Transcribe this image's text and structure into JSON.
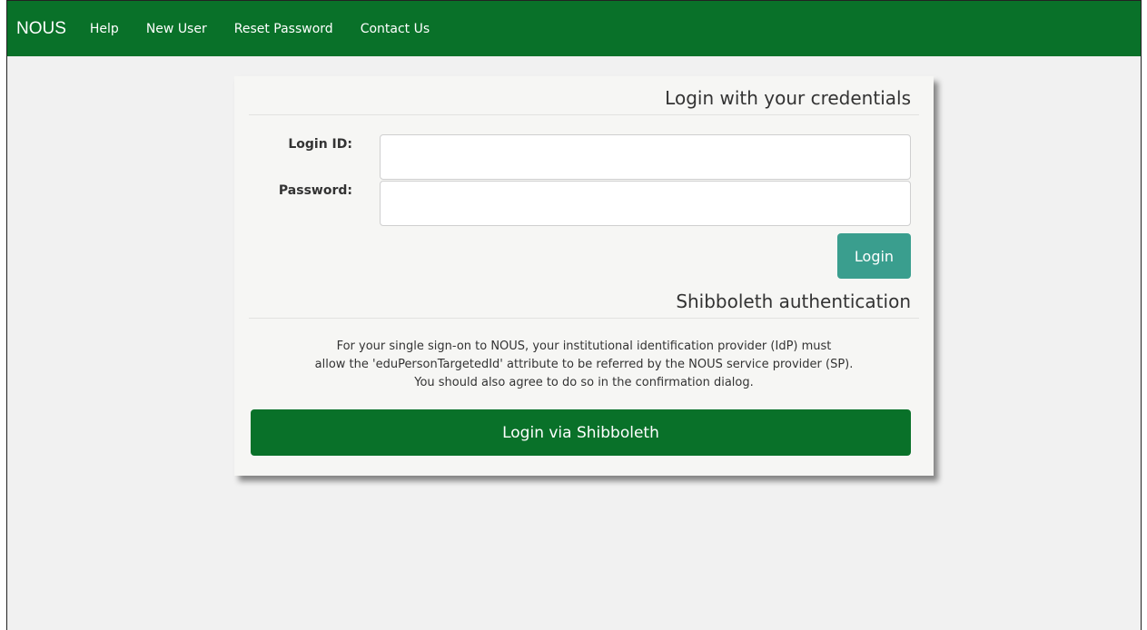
{
  "nav": {
    "brand": "NOUS",
    "links": [
      "Help",
      "New User",
      "Reset Password",
      "Contact Us"
    ]
  },
  "login_section": {
    "title": "Login with your credentials",
    "login_id_label": "Login ID:",
    "password_label": "Password:",
    "login_id_value": "",
    "password_value": "",
    "login_button": "Login"
  },
  "shibboleth_section": {
    "title": "Shibboleth authentication",
    "info_lines": [
      "For your single sign-on to NOUS, your institutional identification provider (IdP) must",
      "allow the 'eduPersonTargetedId' attribute to be referred by the NOUS service provider (SP).",
      "You should also agree to do so in the confirmation dialog."
    ],
    "button": "Login via Shibboleth"
  },
  "colors": {
    "nav_green": "#097129",
    "login_button_teal": "#3a9e8e",
    "page_background": "#f1f1f1"
  }
}
